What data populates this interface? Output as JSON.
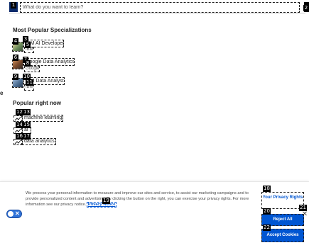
{
  "search": {
    "placeholder": "What do you want to learn?"
  },
  "left_edge_fragment": "e",
  "specializations": {
    "title": "Most Popular Specializations",
    "items": [
      {
        "title": "IBM AI Developer",
        "subtitle": "IBM"
      },
      {
        "title": "Google Data Analytics",
        "subtitle": "Google"
      },
      {
        "title": "IBM Data Analyst",
        "subtitle": "IBM"
      }
    ]
  },
  "popular": {
    "title": "Popular right now",
    "items": [
      {
        "label": "machine learning"
      },
      {
        "label": "ai"
      },
      {
        "label": "data analytics"
      }
    ]
  },
  "cookie_banner": {
    "text_before_link": "We process your personal information to measure and improve our sites and service, to assist our marketing campaigns and to provide personalized content and advertising. By clicking the button on the right, you can exercise your privacy rights. For more information see our privacy notice.",
    "privacy_notice_link": "Privacy Notice",
    "toggle_glyph": "✕",
    "privacy_rights_button": "Your Privacy Rights",
    "reject_button": "Reject All",
    "accept_button": "Accept Cookies",
    "close_glyph": "✕"
  },
  "marker_labels": [
    "1",
    "2",
    "3",
    "4",
    "5",
    "6",
    "7",
    "8",
    "9",
    "10",
    "11",
    "12",
    "13",
    "14",
    "15",
    "16",
    "17",
    "18",
    "19",
    "20",
    "21",
    "22"
  ],
  "colors": {
    "accent": "#0056d2",
    "logo": "#0a2a6b",
    "toggle": "#2f73d9"
  },
  "icons": [
    "search-logo-icon",
    "trending-icon",
    "close-icon"
  ]
}
